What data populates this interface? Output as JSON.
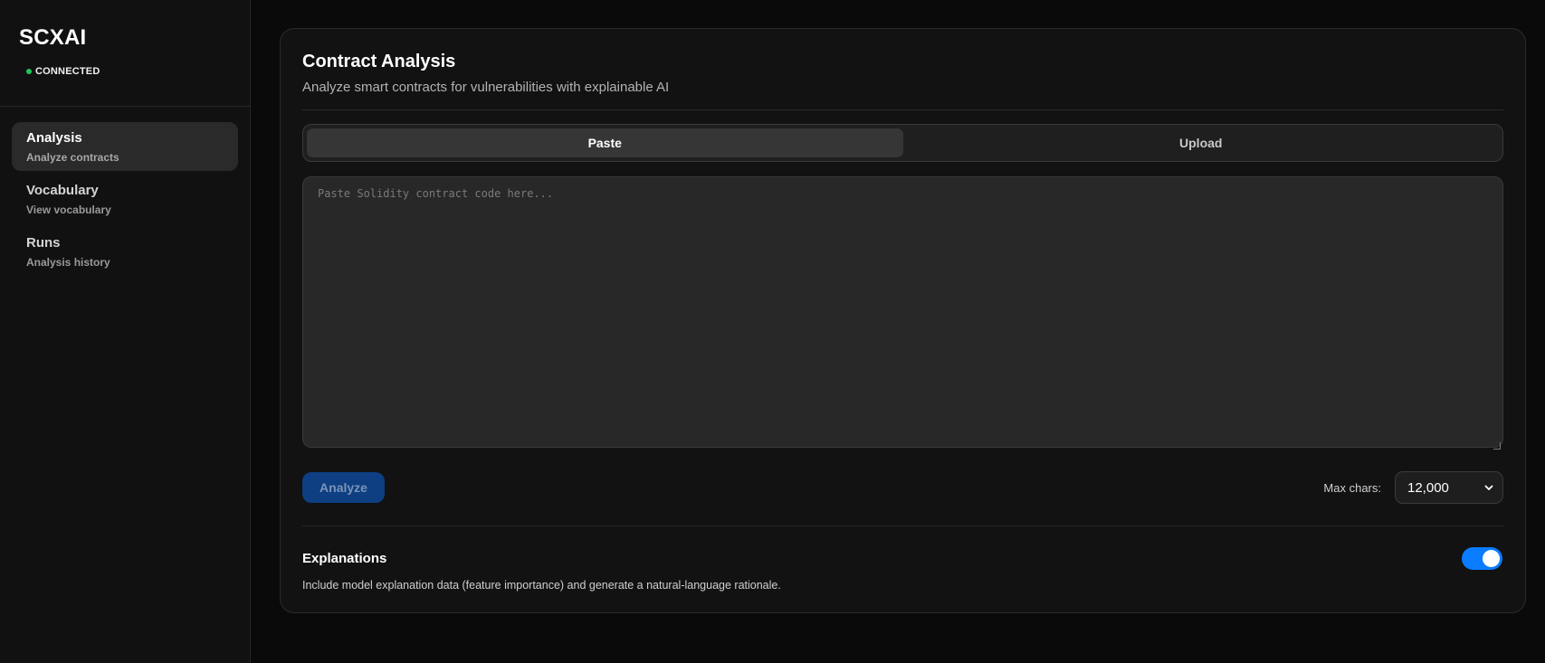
{
  "app": {
    "title": "SCXAI",
    "status": "CONNECTED",
    "status_color": "#22c55e",
    "accent": "#0a7cff"
  },
  "sidebar": {
    "items": [
      {
        "label": "Analysis",
        "sub": "Analyze contracts",
        "active": true
      },
      {
        "label": "Vocabulary",
        "sub": "View vocabulary",
        "active": false
      },
      {
        "label": "Runs",
        "sub": "Analysis history",
        "active": false
      }
    ]
  },
  "main": {
    "title": "Contract Analysis",
    "subtitle": "Analyze smart contracts for vulnerabilities with explainable AI",
    "tabs": [
      {
        "label": "Paste",
        "active": true
      },
      {
        "label": "Upload",
        "active": false
      }
    ],
    "code": {
      "value": "",
      "placeholder": "Paste Solidity contract code here..."
    },
    "analyze_label": "Analyze",
    "max_chars": {
      "label": "Max chars:",
      "value": "12,000"
    },
    "explanations": {
      "title": "Explanations",
      "description": "Include model explanation data (feature importance) and generate a natural-language rationale.",
      "enabled": true
    }
  }
}
